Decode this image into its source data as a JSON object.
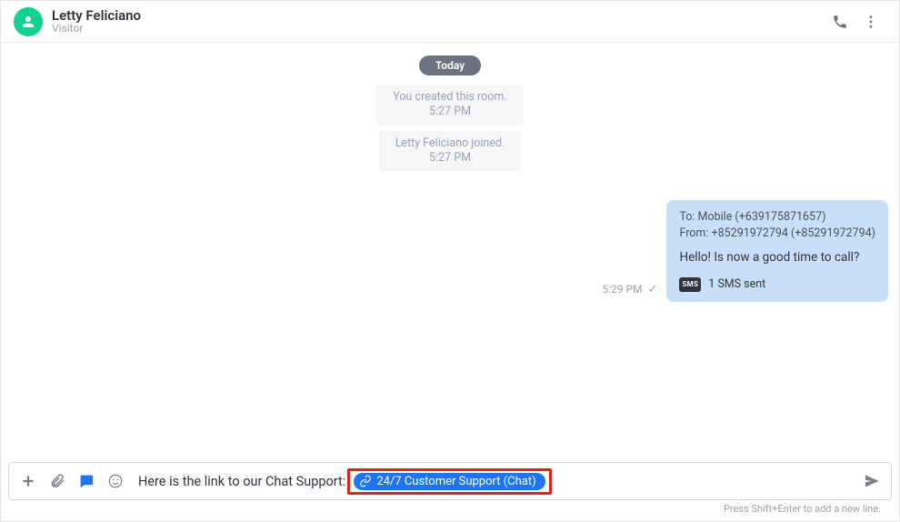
{
  "header": {
    "name": "Letty Feliciano",
    "subtitle": "Visitor"
  },
  "date_separator": "Today",
  "system_events": [
    {
      "text": "You created this room.",
      "time": "5:27 PM"
    },
    {
      "text": "Letty Feliciano joined.",
      "time": "5:27 PM"
    }
  ],
  "message": {
    "to_line": "To: Mobile (+639175871657)",
    "from_line": "From: +85291972794 (+85291972794)",
    "body": "Hello! Is now a good time to call?",
    "sms_status": "1 SMS sent",
    "sms_badge": "SMS",
    "time": "5:29 PM"
  },
  "composer": {
    "text_prefix": "Here is the link to our Chat Support: ",
    "link_label": "24/7 Customer Support (Chat)",
    "hint": "Press Shift+Enter to add a new line."
  }
}
